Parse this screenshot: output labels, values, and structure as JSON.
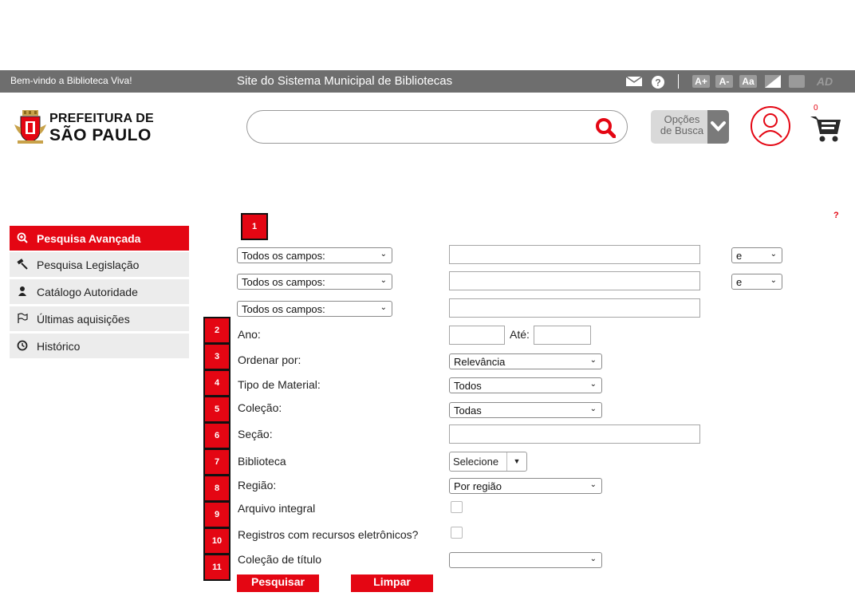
{
  "topbar": {
    "welcome": "Bem-vindo a Biblioteca Viva!",
    "site_title": "Site do Sistema Municipal de Bibliotecas",
    "icons": [
      "mail-icon",
      "help-icon",
      "font-increase-icon",
      "font-decrease-icon",
      "font-reset-icon",
      "contrast-icon",
      "square-icon",
      "audio-description-icon"
    ],
    "font_increase": "A+",
    "font_decrease": "A-",
    "font_reset": "Aa",
    "ad_label": "AD"
  },
  "header": {
    "logo_line1": "PREFEITURA DE",
    "logo_line2": "SÃO PAULO",
    "search_placeholder": "",
    "options_label_1": "Opções",
    "options_label_2": "de Busca",
    "cart_count": "0"
  },
  "sidebar": {
    "items": [
      {
        "label": "Pesquisa Avançada",
        "icon": "search-plus-icon",
        "active": true
      },
      {
        "label": "Pesquisa Legislação",
        "icon": "gavel-icon",
        "active": false
      },
      {
        "label": "Catálogo Autoridade",
        "icon": "person-icon",
        "active": false
      },
      {
        "label": "Últimas aquisições",
        "icon": "flag-icon",
        "active": false
      },
      {
        "label": "Histórico",
        "icon": "clock-icon",
        "active": false
      }
    ]
  },
  "form": {
    "help_mark": "?",
    "badges": [
      "1",
      "2",
      "3",
      "4",
      "5",
      "6",
      "7",
      "8",
      "9",
      "10",
      "11"
    ],
    "field_selects": [
      "Todos os campos:",
      "Todos os campos:",
      "Todos os campos:"
    ],
    "operators": [
      "e",
      "e"
    ],
    "ano_label": "Ano:",
    "ate_label": "Até:",
    "ordenar_label": "Ordenar por:",
    "ordenar_value": "Relevância",
    "tipo_label": "Tipo de Material:",
    "tipo_value": "Todos",
    "colecao_label": "Coleção:",
    "colecao_value": "Todas",
    "secao_label": "Seção:",
    "biblioteca_label": "Biblioteca",
    "biblioteca_value": "Selecione",
    "regiao_label": "Região:",
    "regiao_value": "Por região",
    "arquivo_label": "Arquivo integral",
    "registros_label": "Registros com recursos eletrônicos?",
    "colecao_titulo_label": "Coleção de título",
    "colecao_titulo_value": "",
    "search_button": "Pesquisar",
    "clear_button": "Limpar"
  },
  "colors": {
    "accent": "#e40613",
    "topbar": "#6e6e6e",
    "sidebar": "#ececec"
  }
}
